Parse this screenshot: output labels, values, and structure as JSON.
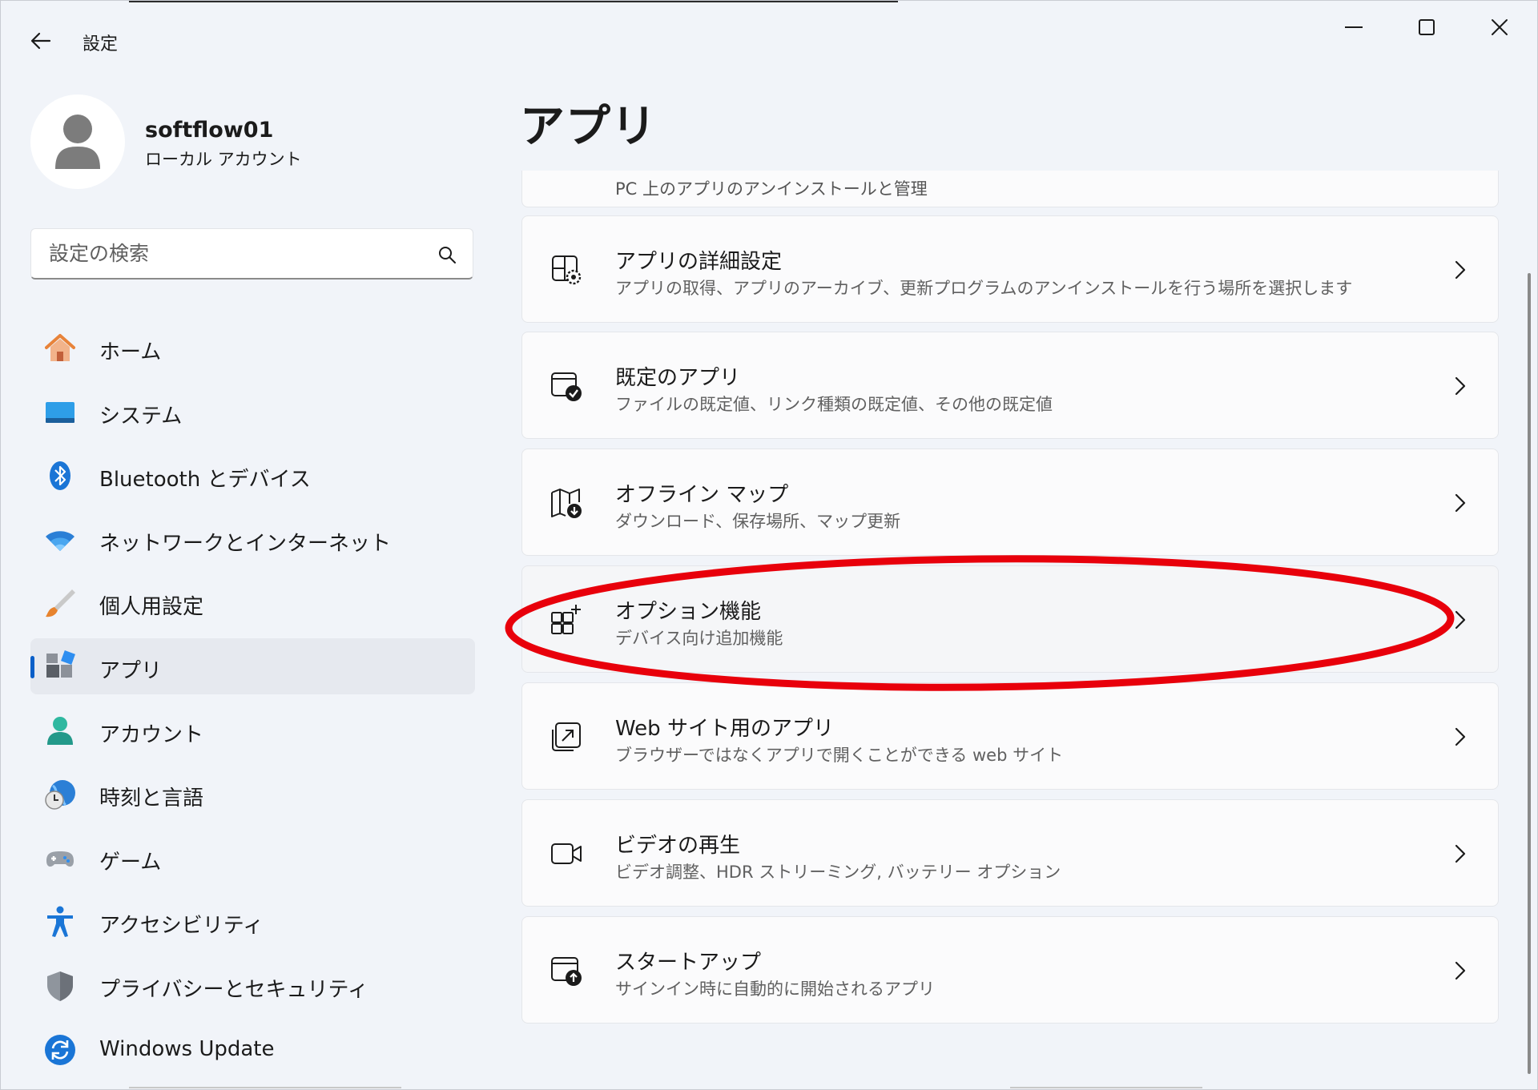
{
  "window": {
    "title": "設定",
    "controls": {
      "minimize": "minimize",
      "maximize": "maximize",
      "close": "close"
    }
  },
  "account": {
    "name": "softflow01",
    "type": "ローカル アカウント"
  },
  "search": {
    "placeholder": "設定の検索",
    "value": ""
  },
  "sidebar": {
    "active_index": 5,
    "items": [
      {
        "label": "ホーム",
        "icon": "home-icon"
      },
      {
        "label": "システム",
        "icon": "system-icon"
      },
      {
        "label": "Bluetooth とデバイス",
        "icon": "bluetooth-icon"
      },
      {
        "label": "ネットワークとインターネット",
        "icon": "wifi-icon"
      },
      {
        "label": "個人用設定",
        "icon": "brush-icon"
      },
      {
        "label": "アプリ",
        "icon": "apps-icon"
      },
      {
        "label": "アカウント",
        "icon": "person-icon"
      },
      {
        "label": "時刻と言語",
        "icon": "clock-globe-icon"
      },
      {
        "label": "ゲーム",
        "icon": "gamepad-icon"
      },
      {
        "label": "アクセシビリティ",
        "icon": "accessibility-icon"
      },
      {
        "label": "プライバシーとセキュリティ",
        "icon": "shield-icon"
      },
      {
        "label": "Windows Update",
        "icon": "update-icon"
      }
    ]
  },
  "main": {
    "page_title": "アプリ",
    "partial_card_subtitle": "PC 上のアプリのアンインストールと管理",
    "cards": [
      {
        "title": "アプリの詳細設定",
        "subtitle": "アプリの取得、アプリのアーカイブ、更新プログラムのアンインストールを行う場所を選択します",
        "icon": "advanced-apps-icon"
      },
      {
        "title": "既定のアプリ",
        "subtitle": "ファイルの既定値、リンク種類の既定値、その他の既定値",
        "icon": "default-apps-icon"
      },
      {
        "title": "オフライン マップ",
        "subtitle": "ダウンロード、保存場所、マップ更新",
        "icon": "offline-map-icon"
      },
      {
        "title": "オプション機能",
        "subtitle": "デバイス向け追加機能",
        "icon": "optional-features-icon"
      },
      {
        "title": "Web サイト用のアプリ",
        "subtitle": "ブラウザーではなくアプリで開くことができる web サイト",
        "icon": "web-apps-icon"
      },
      {
        "title": "ビデオの再生",
        "subtitle": "ビデオ調整、HDR ストリーミング, バッテリー オプション",
        "icon": "video-icon"
      },
      {
        "title": "スタートアップ",
        "subtitle": "サインイン時に自動的に開始されるアプリ",
        "icon": "startup-icon"
      }
    ]
  },
  "colors": {
    "accent": "#0a5fc8",
    "annotation": "#e8000b",
    "window_bg": "#f1f4f9",
    "card_bg": "#fbfbfc"
  }
}
